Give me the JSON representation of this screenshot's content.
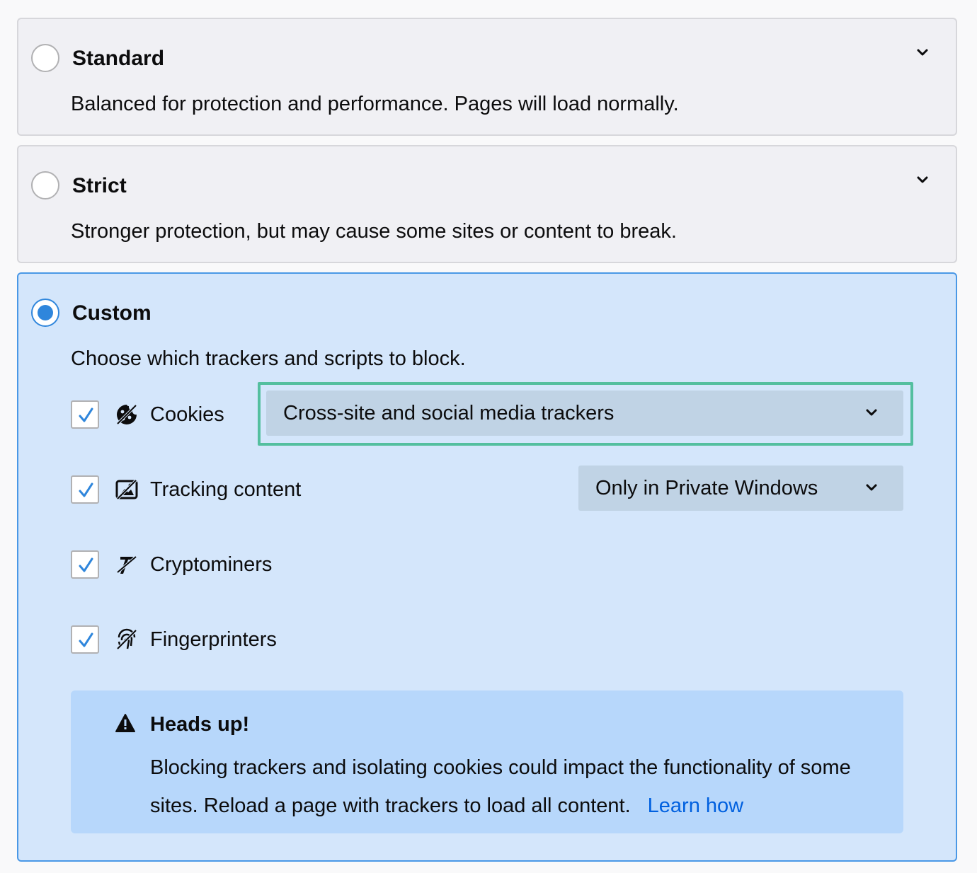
{
  "options": [
    {
      "title": "Standard",
      "description": "Balanced for protection and performance. Pages will load normally."
    },
    {
      "title": "Strict",
      "description": "Stronger protection, but may cause some sites or content to break."
    },
    {
      "title": "Custom",
      "description": "Choose which trackers and scripts to block."
    }
  ],
  "selected_option": "Custom",
  "custom": {
    "items": [
      {
        "label": "Cookies",
        "checked": true,
        "icon": "cookie-icon",
        "select_value": "Cross-site and social media trackers"
      },
      {
        "label": "Tracking content",
        "checked": true,
        "icon": "tracking-content-icon",
        "select_value": "Only in Private Windows"
      },
      {
        "label": "Cryptominers",
        "checked": true,
        "icon": "cryptominer-icon"
      },
      {
        "label": "Fingerprinters",
        "checked": true,
        "icon": "fingerprint-icon"
      }
    ],
    "notice": {
      "title": "Heads up!",
      "text": "Blocking trackers and isolating cookies could impact the functionality of some sites. Reload a page with trackers to load all content.",
      "link": "Learn how",
      "icon": "warning-icon"
    }
  },
  "colors": {
    "accent": "#2f86dc",
    "custom_background": "#d4e6fb",
    "notice_background": "#b7d7fb",
    "focus_ring": "#54bf9f",
    "link": "#0060df"
  }
}
